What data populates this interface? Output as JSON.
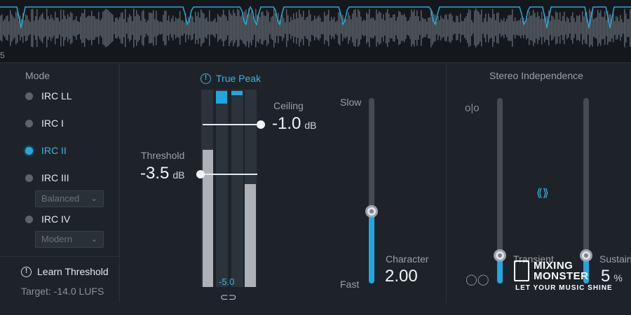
{
  "waveform": {
    "edge_label": "5"
  },
  "mode": {
    "title": "Mode",
    "items": [
      {
        "label": "IRC LL",
        "active": false
      },
      {
        "label": "IRC I",
        "active": false
      },
      {
        "label": "IRC II",
        "active": true
      },
      {
        "label": "IRC III",
        "active": false
      },
      {
        "label": "IRC IV",
        "active": false
      }
    ],
    "irc3_option": "Balanced",
    "irc4_option": "Modern",
    "learn_threshold": "Learn Threshold",
    "target": "Target: -14.0 LUFS"
  },
  "true_peak": {
    "label": "True Peak",
    "meter_readout": "-5.0"
  },
  "threshold": {
    "caption": "Threshold",
    "value": "-3.5",
    "unit": "dB"
  },
  "ceiling": {
    "caption": "Ceiling",
    "value": "-1.0",
    "unit": "dB"
  },
  "character": {
    "slow_label": "Slow",
    "fast_label": "Fast",
    "caption": "Character",
    "value": "2.00",
    "level": 0.39
  },
  "stereo": {
    "title": "Stereo Independence",
    "transient_caption": "Transient",
    "sustain_caption": "Sustain",
    "sustain_value_partial": "5",
    "sustain_unit": "%",
    "transient_level": 0.15,
    "sustain_level": 0.15
  },
  "watermark": {
    "line1": "MIXING",
    "line2": "MONSTER",
    "tagline": "LET YOUR MUSIC SHINE"
  },
  "colors": {
    "accent": "#22a6e0",
    "background": "#1e2329",
    "meter_fill": "#aeb2b7"
  }
}
